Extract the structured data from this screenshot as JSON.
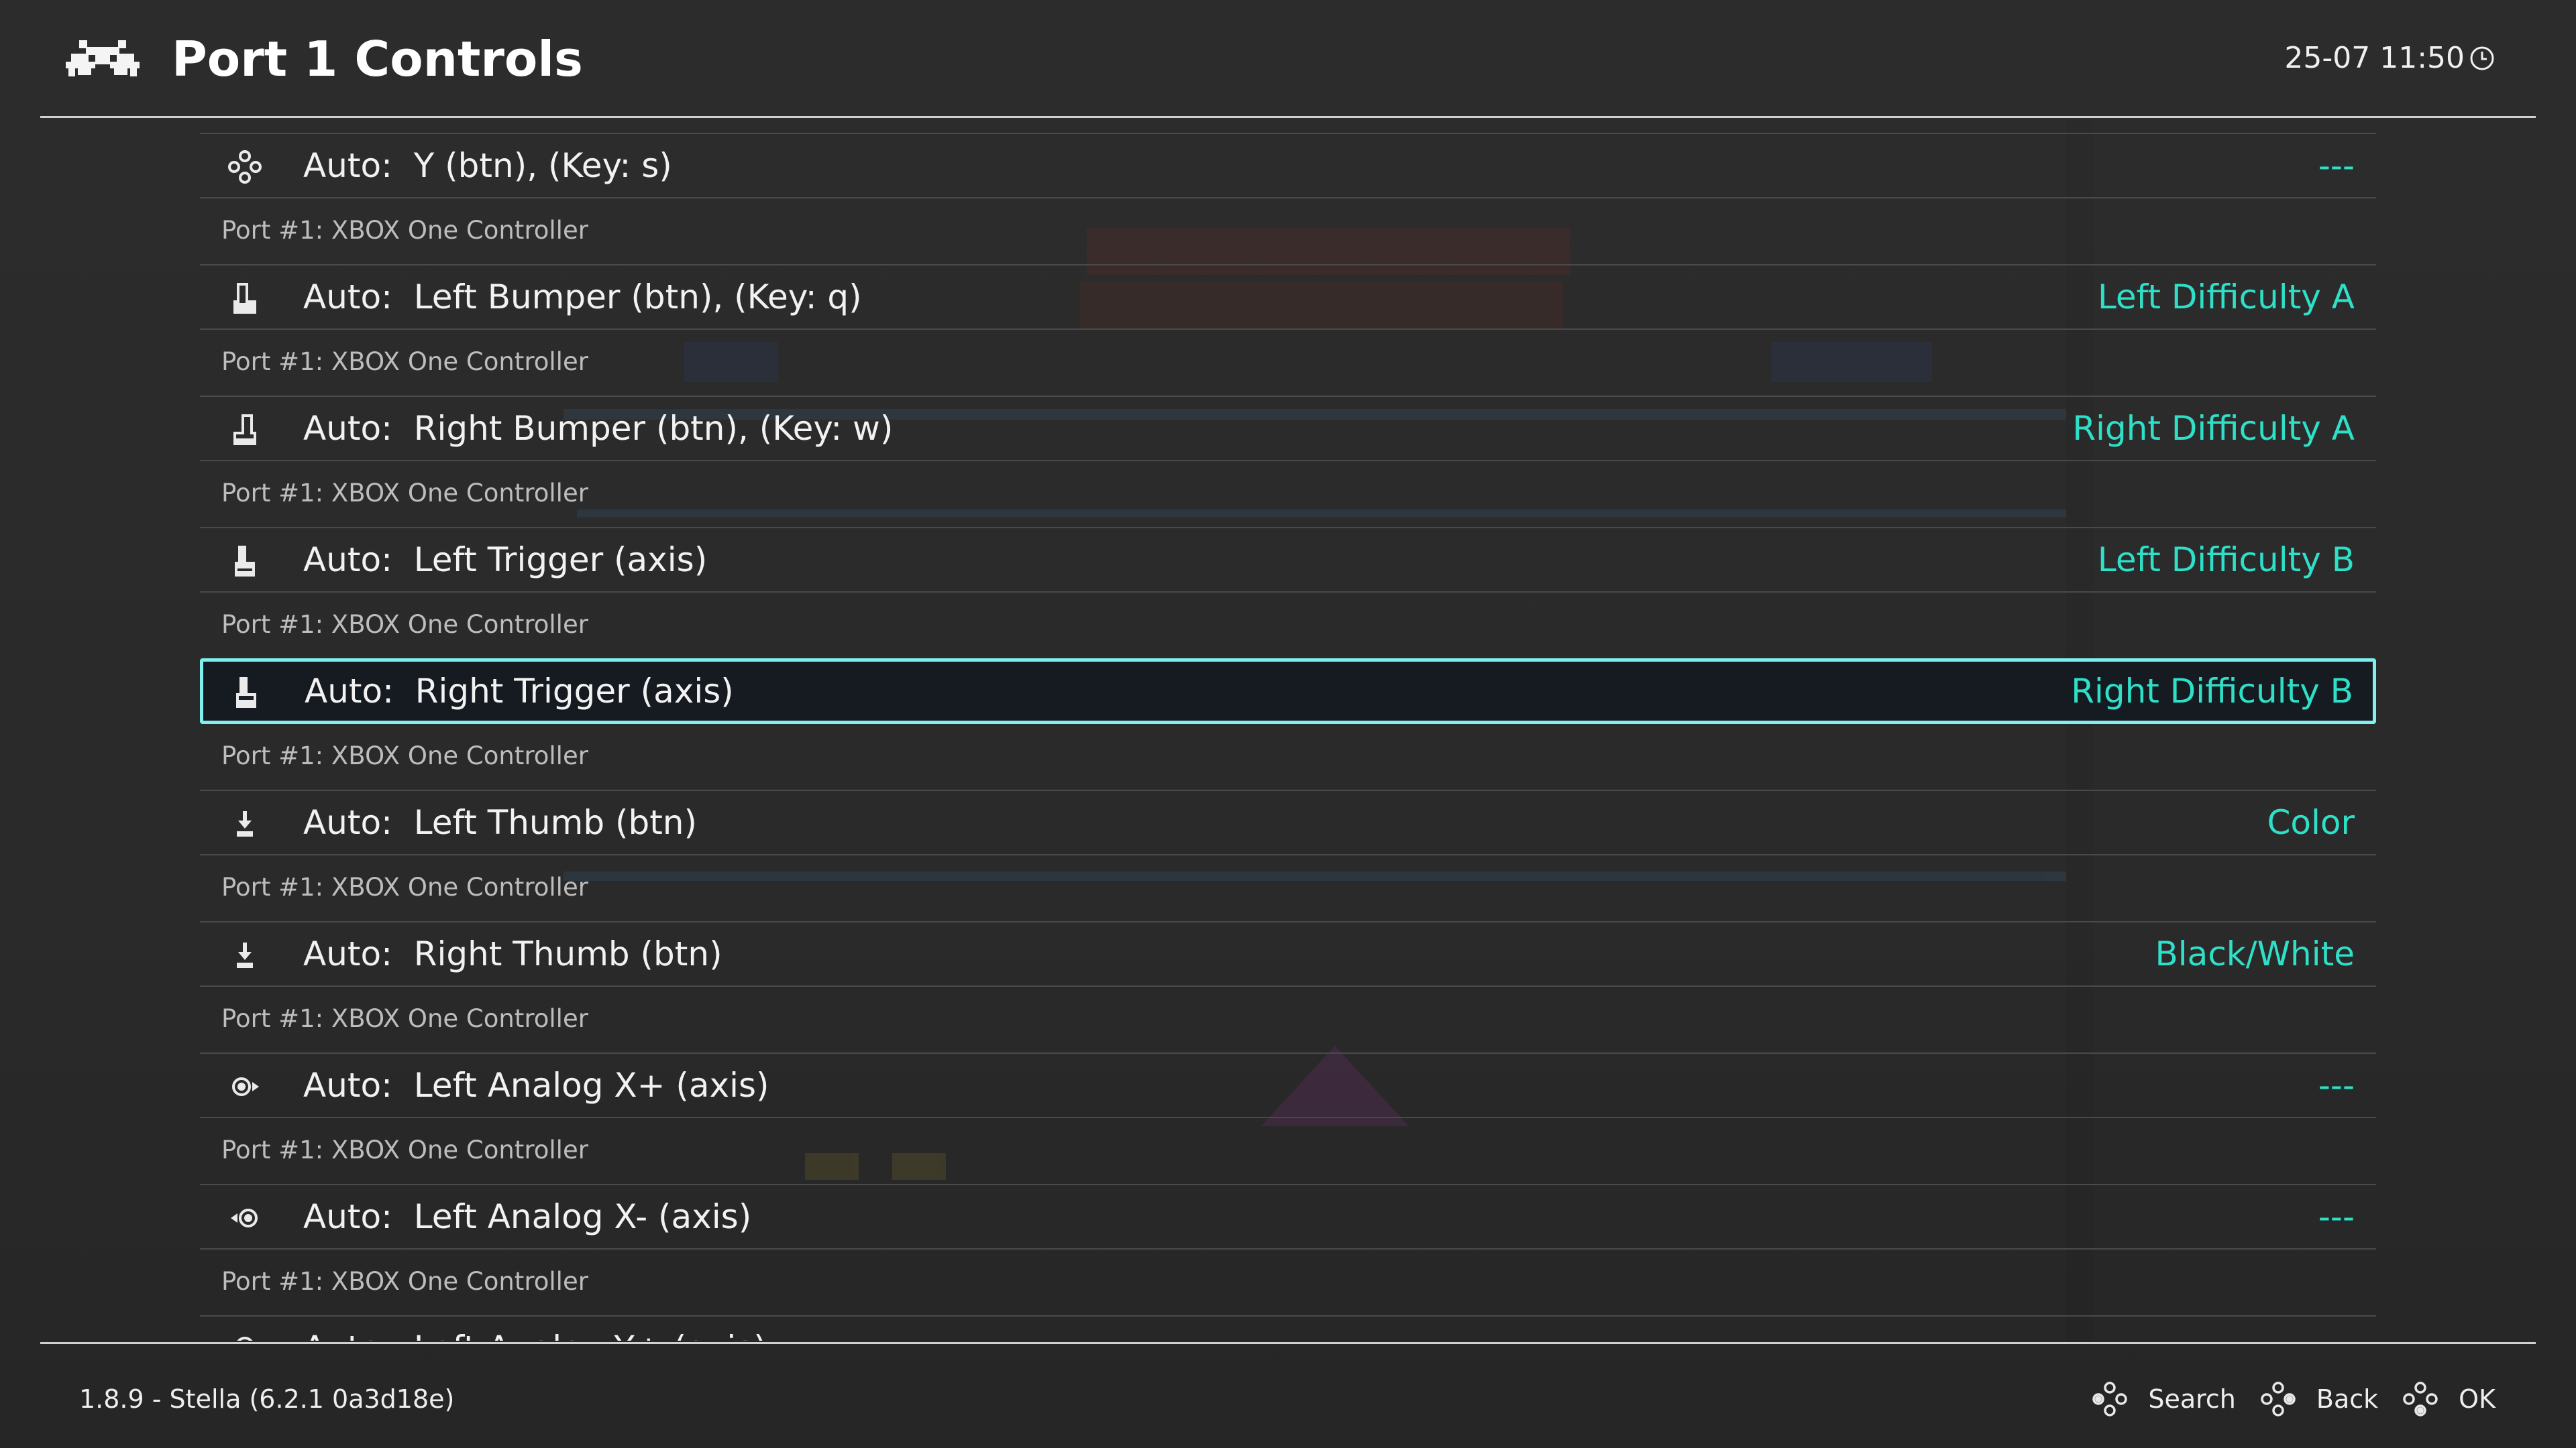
{
  "header": {
    "title": "Port 1 Controls",
    "clock": "25-07 11:50",
    "logo_icon": "retroarch-invader-icon",
    "clock_icon": "clock-icon"
  },
  "colors": {
    "accent": "#2ee0c8",
    "selection_border": "#7ff0ee",
    "background": "#2b2b2b",
    "text": "#ededed",
    "sublabel": "#bdbdbd"
  },
  "list": {
    "items": [
      {
        "icon": "face-buttons-icon",
        "prefix": "Auto:",
        "label": "Y (btn), (Key: s)",
        "value": "---",
        "sublabel": "Port #1: XBOX One Controller",
        "selected": false
      },
      {
        "icon": "left-bumper-icon",
        "prefix": "Auto:",
        "label": "Left Bumper (btn), (Key: q)",
        "value": "Left Difficulty A",
        "sublabel": "Port #1: XBOX One Controller",
        "selected": false
      },
      {
        "icon": "right-bumper-icon",
        "prefix": "Auto:",
        "label": "Right Bumper (btn), (Key: w)",
        "value": "Right Difficulty A",
        "sublabel": "Port #1: XBOX One Controller",
        "selected": false
      },
      {
        "icon": "left-trigger-icon",
        "prefix": "Auto:",
        "label": "Left Trigger (axis)",
        "value": "Left Difficulty B",
        "sublabel": "Port #1: XBOX One Controller",
        "selected": false
      },
      {
        "icon": "right-trigger-icon",
        "prefix": "Auto:",
        "label": "Right Trigger (axis)",
        "value": "Right Difficulty B",
        "sublabel": "Port #1: XBOX One Controller",
        "selected": true
      },
      {
        "icon": "left-thumb-icon",
        "prefix": "Auto:",
        "label": "Left Thumb (btn)",
        "value": "Color",
        "sublabel": "Port #1: XBOX One Controller",
        "selected": false
      },
      {
        "icon": "right-thumb-icon",
        "prefix": "Auto:",
        "label": "Right Thumb (btn)",
        "value": "Black/White",
        "sublabel": "Port #1: XBOX One Controller",
        "selected": false
      },
      {
        "icon": "analog-right-icon",
        "prefix": "Auto:",
        "label": "Left Analog X+ (axis)",
        "value": "---",
        "sublabel": "Port #1: XBOX One Controller",
        "selected": false
      },
      {
        "icon": "analog-left-icon",
        "prefix": "Auto:",
        "label": "Left Analog X- (axis)",
        "value": "---",
        "sublabel": "Port #1: XBOX One Controller",
        "selected": false
      },
      {
        "icon": "analog-down-icon",
        "prefix": "Auto:",
        "label": "Left Analog Y+ (axis)",
        "value": "",
        "sublabel": "",
        "selected": false
      }
    ]
  },
  "footer": {
    "version": "1.8.9 - Stella (6.2.1 0a3d18e)",
    "hints": [
      {
        "icon": "gamepad-face-icon",
        "label": "Search"
      },
      {
        "icon": "gamepad-face-icon",
        "label": "Back"
      },
      {
        "icon": "gamepad-face-icon",
        "label": "OK"
      }
    ]
  }
}
